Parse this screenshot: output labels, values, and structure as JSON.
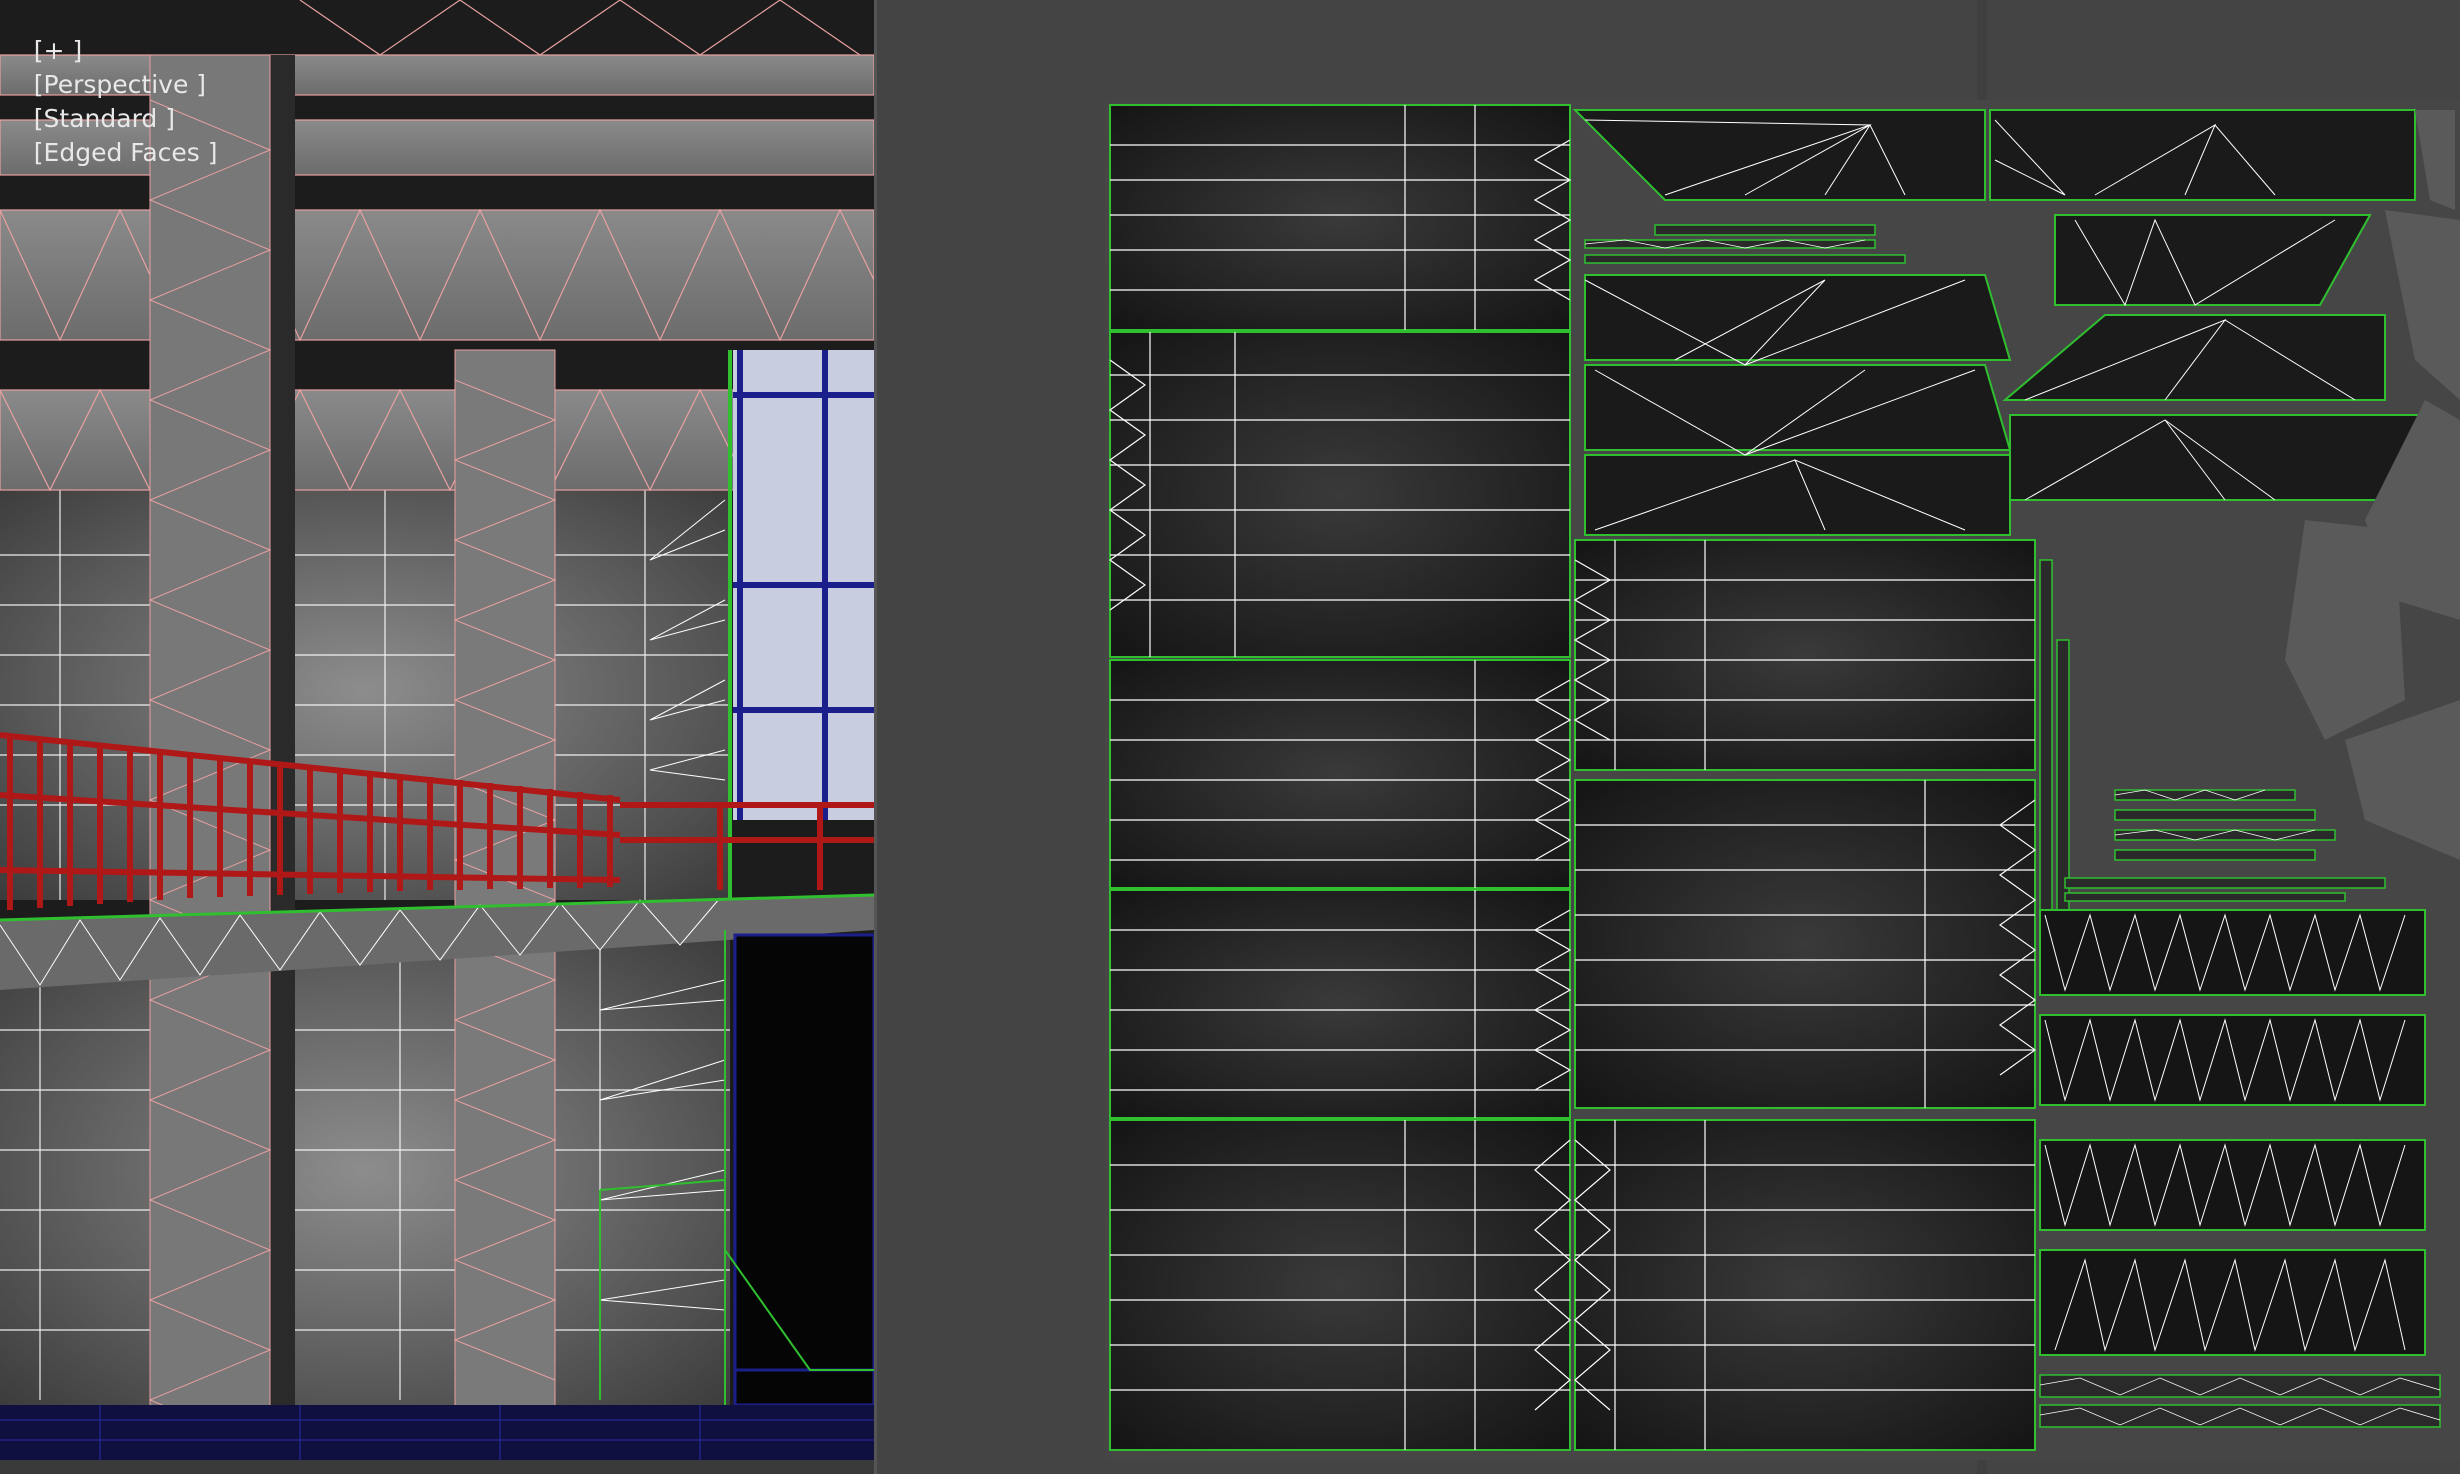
{
  "viewport": {
    "label": {
      "menu": "[+ ]",
      "view": "[Perspective ]",
      "shading": "[Standard ]",
      "display": "[Edged Faces ]"
    }
  },
  "colors": {
    "uv_island_border": "#2fbf2f",
    "uv_edge": "#ffffff",
    "wireframe_selected": "#e8a0a0",
    "railing": "#b01818",
    "window_frame": "#1a1f8c",
    "sky": "#c9cde0",
    "concrete": "#7a7a7a",
    "panel_bg": "#444444"
  },
  "uv_editor": {
    "islands_count": "many"
  }
}
